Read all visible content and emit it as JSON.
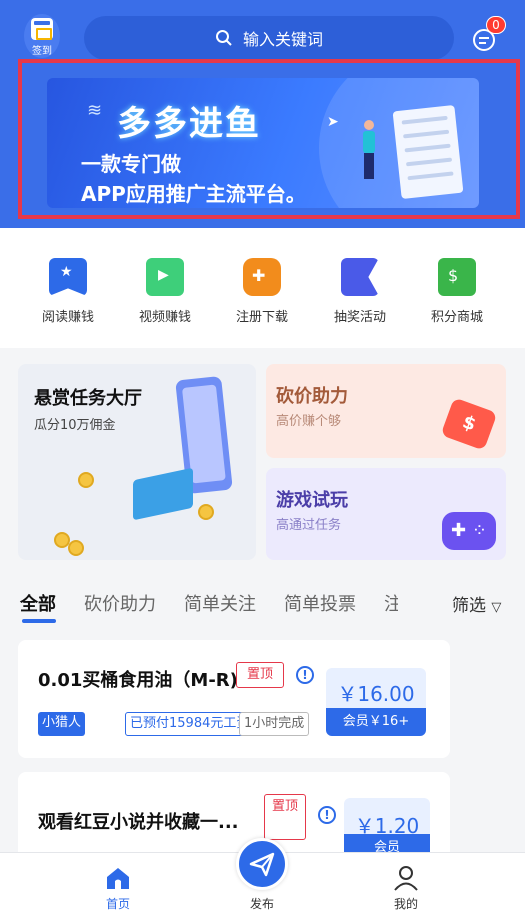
{
  "header": {
    "checkin_label": "签到",
    "search_placeholder": "输入关键词",
    "message_badge": "0"
  },
  "banner": {
    "title": "多多进鱼",
    "line1": "一款专门做",
    "line2": "APP应用推广主流平台。"
  },
  "nav_items": [
    {
      "label": "阅读赚钱",
      "icon": "book-star-icon",
      "color": "#2d6ae8"
    },
    {
      "label": "视频赚钱",
      "icon": "video-camera-icon",
      "color": "#3ecf7a"
    },
    {
      "label": "注册下载",
      "icon": "gamepad-icon",
      "color": "#f28c1c"
    },
    {
      "label": "抽奖活动",
      "icon": "flag-icon",
      "color": "#4a5ae8"
    },
    {
      "label": "积分商城",
      "icon": "shop-icon",
      "color": "#3ab54a"
    }
  ],
  "promo": {
    "main": {
      "title": "悬赏任务大厅",
      "subtitle": "瓜分10万佣金"
    },
    "bargain": {
      "title": "砍价助力",
      "subtitle": "高价赚个够"
    },
    "game": {
      "title": "游戏试玩",
      "subtitle": "高通过任务"
    }
  },
  "tabs": {
    "items": [
      "全部",
      "砍价助力",
      "简单关注",
      "简单投票",
      "注"
    ],
    "filter_label": "筛选"
  },
  "tasks": [
    {
      "title": "0.01买桶食用油（M-R)",
      "top_tag": "置顶",
      "warn": "!",
      "tags": [
        "小猎人",
        "已预付15984元工资",
        "1小时完成"
      ],
      "price": "￥16.00",
      "vip_price": "会员￥16+"
    },
    {
      "title": "观看红豆小说并收藏一...",
      "top_tag": "置顶",
      "warn": "!",
      "price": "￥1.20",
      "vip_price": "会员"
    }
  ],
  "bottom_nav": {
    "home": "首页",
    "publish": "发布",
    "mine": "我的"
  },
  "colors": {
    "primary": "#2d6ae8",
    "header_bg": "#3a6ee8",
    "danger": "#e5384a"
  }
}
